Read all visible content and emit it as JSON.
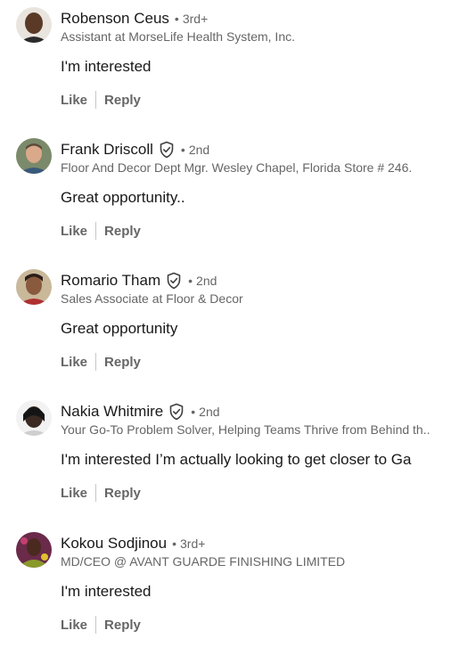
{
  "comments": [
    {
      "name": "Robenson Ceus",
      "verified": false,
      "degree": "3rd+",
      "headline": "Assistant at MorseLife Health System, Inc.",
      "text": "I'm interested",
      "like_label": "Like",
      "reply_label": "Reply"
    },
    {
      "name": "Frank Driscoll",
      "verified": true,
      "degree": "2nd",
      "headline": "Floor And Decor Dept Mgr. Wesley Chapel, Florida Store # 246.",
      "text": "Great opportunity..",
      "like_label": "Like",
      "reply_label": "Reply"
    },
    {
      "name": "Romario Tham",
      "verified": true,
      "degree": "2nd",
      "headline": "Sales Associate at Floor & Decor",
      "text": "Great opportunity",
      "like_label": "Like",
      "reply_label": "Reply"
    },
    {
      "name": "Nakia Whitmire",
      "verified": true,
      "degree": "2nd",
      "headline": "Your Go-To Problem Solver, Helping Teams Thrive from Behind th..",
      "text": "I'm interested I’m actually looking to get closer to Ga",
      "like_label": "Like",
      "reply_label": "Reply"
    },
    {
      "name": "Kokou Sodjinou",
      "verified": false,
      "degree": "3rd+",
      "headline": "MD/CEO @ AVANT GUARDE FINISHING LIMITED",
      "text": "I'm interested",
      "like_label": "Like",
      "reply_label": "Reply"
    }
  ],
  "separator_dot": "•",
  "colors": {
    "name": "#191919",
    "secondary": "#666666",
    "divider": "#c8c8c8"
  }
}
